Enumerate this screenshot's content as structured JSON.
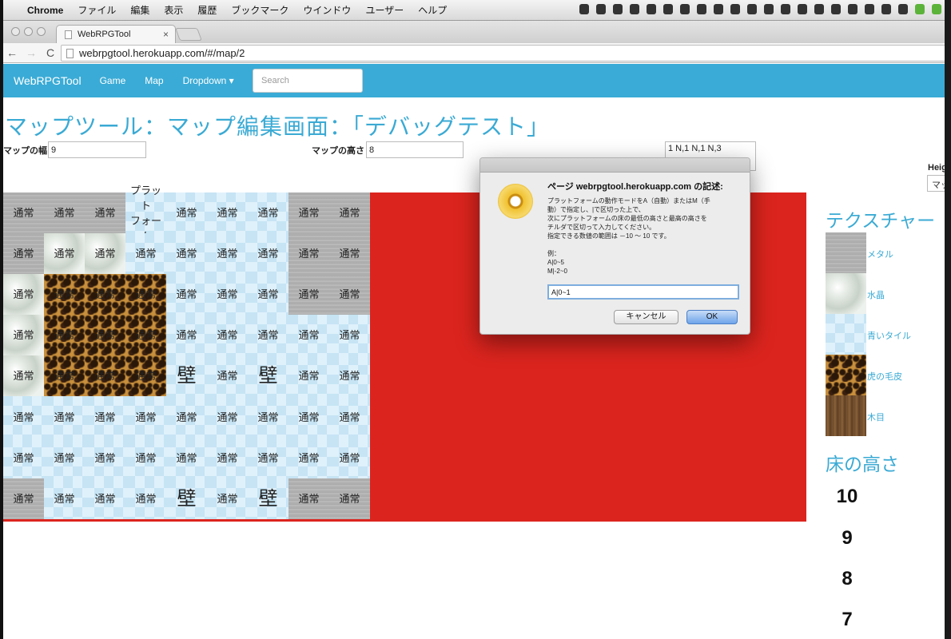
{
  "menubar": {
    "apple": "",
    "items": [
      "Chrome",
      "ファイル",
      "編集",
      "表示",
      "履歴",
      "ブックマーク",
      "ウインドウ",
      "ユーザー",
      "ヘルプ"
    ]
  },
  "browser": {
    "tab_title": "WebRPGTool",
    "tab_close": "×",
    "url": "webrpgtool.herokuapp.com/#/map/2"
  },
  "navbar": {
    "brand": "WebRPGTool",
    "links": [
      "Game",
      "Map",
      "Dropdown ▾"
    ],
    "search_placeholder": "Search"
  },
  "page": {
    "title": "マップツール：マップ編集画面：「デバッグテスト」",
    "width_label": "マップの幅",
    "width_value": "9",
    "height_label": "マップの高さ",
    "height_value": "8",
    "textarea_value": "1 N,1 N,1 N,3",
    "height_select_label": "Heigh",
    "height_select_value": "マッ"
  },
  "map": {
    "columns": 9,
    "rows": [
      [
        {
          "t": "metal",
          "l": "通常"
        },
        {
          "t": "metal",
          "l": "通常"
        },
        {
          "t": "metal",
          "l": "通常"
        },
        {
          "t": "blue",
          "l": "プラット\nフォーム"
        },
        {
          "t": "blue",
          "l": "通常"
        },
        {
          "t": "blue",
          "l": "通常"
        },
        {
          "t": "blue",
          "l": "通常"
        },
        {
          "t": "metal",
          "l": "通常"
        },
        {
          "t": "metal",
          "l": "通常"
        }
      ],
      [
        {
          "t": "metal",
          "l": "通常"
        },
        {
          "t": "crystal",
          "l": "通常"
        },
        {
          "t": "crystal",
          "l": "通常"
        },
        {
          "t": "blue",
          "l": "通常"
        },
        {
          "t": "blue",
          "l": "通常"
        },
        {
          "t": "blue",
          "l": "通常"
        },
        {
          "t": "blue",
          "l": "通常"
        },
        {
          "t": "metal",
          "l": "通常"
        },
        {
          "t": "metal",
          "l": "通常"
        }
      ],
      [
        {
          "t": "crystal",
          "l": "通常"
        },
        {
          "t": "tiger",
          "l": "通常"
        },
        {
          "t": "tiger",
          "l": "通常"
        },
        {
          "t": "tiger",
          "l": "通常"
        },
        {
          "t": "blue",
          "l": "通常"
        },
        {
          "t": "blue",
          "l": "通常"
        },
        {
          "t": "blue",
          "l": "通常"
        },
        {
          "t": "metal",
          "l": "通常"
        },
        {
          "t": "metal",
          "l": "通常"
        }
      ],
      [
        {
          "t": "crystal",
          "l": "通常"
        },
        {
          "t": "tiger",
          "l": "通常"
        },
        {
          "t": "tiger",
          "l": "通常"
        },
        {
          "t": "tiger",
          "l": "通常"
        },
        {
          "t": "blue",
          "l": "通常"
        },
        {
          "t": "blue",
          "l": "通常"
        },
        {
          "t": "blue",
          "l": "通常"
        },
        {
          "t": "blue",
          "l": "通常"
        },
        {
          "t": "blue",
          "l": "通常"
        }
      ],
      [
        {
          "t": "crystal",
          "l": "通常"
        },
        {
          "t": "tiger",
          "l": "通常"
        },
        {
          "t": "tiger",
          "l": "通常"
        },
        {
          "t": "tiger",
          "l": "通常"
        },
        {
          "t": "blue",
          "l": "壁",
          "big": true
        },
        {
          "t": "blue",
          "l": "通常"
        },
        {
          "t": "blue",
          "l": "壁",
          "big": true
        },
        {
          "t": "blue",
          "l": "通常"
        },
        {
          "t": "blue",
          "l": "通常"
        }
      ],
      [
        {
          "t": "blue",
          "l": "通常"
        },
        {
          "t": "blue",
          "l": "通常"
        },
        {
          "t": "blue",
          "l": "通常"
        },
        {
          "t": "blue",
          "l": "通常"
        },
        {
          "t": "blue",
          "l": "通常"
        },
        {
          "t": "blue",
          "l": "通常"
        },
        {
          "t": "blue",
          "l": "通常"
        },
        {
          "t": "blue",
          "l": "通常"
        },
        {
          "t": "blue",
          "l": "通常"
        }
      ],
      [
        {
          "t": "blue",
          "l": "通常"
        },
        {
          "t": "blue",
          "l": "通常"
        },
        {
          "t": "blue",
          "l": "通常"
        },
        {
          "t": "blue",
          "l": "通常"
        },
        {
          "t": "blue",
          "l": "通常"
        },
        {
          "t": "blue",
          "l": "通常"
        },
        {
          "t": "blue",
          "l": "通常"
        },
        {
          "t": "blue",
          "l": "通常"
        },
        {
          "t": "blue",
          "l": "通常"
        }
      ],
      [
        {
          "t": "metal",
          "l": "通常"
        },
        {
          "t": "blue",
          "l": "通常"
        },
        {
          "t": "blue",
          "l": "通常"
        },
        {
          "t": "blue",
          "l": "通常"
        },
        {
          "t": "blue",
          "l": "壁",
          "big": true
        },
        {
          "t": "blue",
          "l": "通常"
        },
        {
          "t": "blue",
          "l": "壁",
          "big": true
        },
        {
          "t": "metal",
          "l": "通常"
        },
        {
          "t": "metal",
          "l": "通常"
        }
      ]
    ]
  },
  "textures": {
    "heading": "テクスチャー",
    "items": [
      {
        "label": "メタル",
        "pattern": "metal"
      },
      {
        "label": "水晶",
        "pattern": "crystal"
      },
      {
        "label": "青いタイル",
        "pattern": "blue"
      },
      {
        "label": "虎の毛皮",
        "pattern": "tiger"
      },
      {
        "label": "木目",
        "pattern": "wood"
      }
    ]
  },
  "floor_height": {
    "heading": "床の高さ",
    "values": [
      "10",
      "9",
      "8",
      "7"
    ]
  },
  "dialog": {
    "title": "ページ webrpgtool.herokuapp.com の記述:",
    "message_lines": [
      "プラットフォームの動作モードをA（自動）またはM（手",
      "動）で指定し、|で区切った上で、",
      "次にプラットフォームの床の最低の高さと最高の高さを",
      "チルダで区切って入力してください。",
      "指定できる数値の範囲は －10 ～ 10 です。",
      "",
      "例：",
      "A|0~5",
      "M|-2~0"
    ],
    "input_value": "A|0~1",
    "cancel_label": "キャンセル",
    "ok_label": "OK"
  },
  "colors": {
    "accent": "#3aabd6",
    "canvas_red": "#dc241e"
  }
}
